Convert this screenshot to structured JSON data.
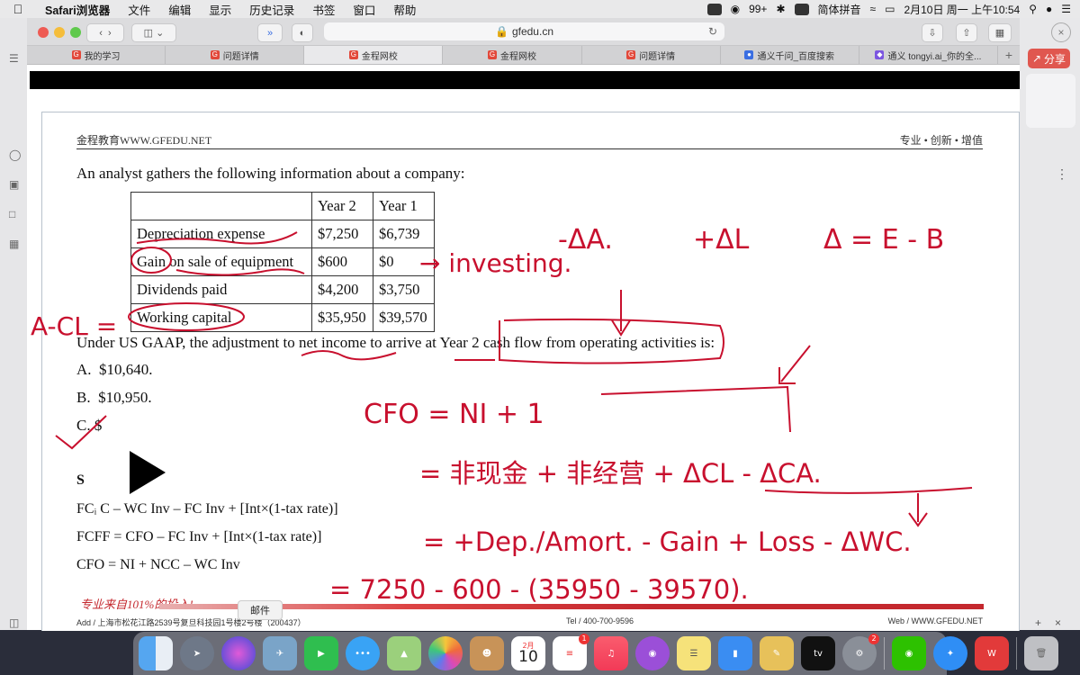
{
  "menubar": {
    "app": "Safari浏览器",
    "items": [
      "文件",
      "编辑",
      "显示",
      "历史记录",
      "书签",
      "窗口",
      "帮助"
    ],
    "notifications": "99+",
    "input_method": "简体拼音",
    "datetime": "2月10日 周一 上午10:54"
  },
  "browser": {
    "url": "gfedu.cn",
    "tabs": [
      {
        "title": "我的学习",
        "active": false
      },
      {
        "title": "问题详情",
        "active": false
      },
      {
        "title": "金程网校",
        "active": true
      },
      {
        "title": "金程网校",
        "active": false
      },
      {
        "title": "问题详情",
        "active": false
      },
      {
        "title": "通义千问_百度搜索",
        "active": false
      },
      {
        "title": "通义 tongyi.ai_你的全...",
        "active": false
      }
    ],
    "share_label": "分享",
    "mail_tooltip": "邮件"
  },
  "doc": {
    "header_left": "金程教育WWW.GFEDU.NET",
    "header_right": "专业 • 创新 • 增值",
    "stem": "An analyst gathers the following information about a company:",
    "table": {
      "headers": [
        "",
        "Year 2",
        "Year 1"
      ],
      "rows": [
        [
          "Depreciation expense",
          "$7,250",
          "$6,739"
        ],
        [
          "Gain on sale of equipment",
          "$600",
          "$0"
        ],
        [
          "Dividends paid",
          "$4,200",
          "$3,750"
        ],
        [
          "Working capital",
          "$35,950",
          "$39,570"
        ]
      ]
    },
    "question": "Under US GAAP, the adjustment to net income to arrive at Year 2 cash flow from operating activities is:",
    "options": [
      {
        "letter": "A.",
        "text": "$10,640."
      },
      {
        "letter": "B.",
        "text": "$10,950."
      },
      {
        "letter": "C.",
        "text": "$"
      }
    ],
    "solution_label": "S",
    "formulas": [
      "FCᵢ          C – WC Inv – FC Inv + [Int×(1-tax rate)]",
      "FCFF = CFO – FC Inv + [Int×(1-tax rate)]",
      "CFO = NI + NCC – WC Inv"
    ],
    "footer_slogan": "专业来自101%的投入!",
    "footer_addr": "Add / 上海市松花江路2539号复旦科技园1号楼2号楼（200437）",
    "footer_tel": "Tel / 400-700-9596",
    "footer_web": "Web / WWW.GFEDU.NET"
  },
  "annotations": {
    "minus_dA": "-ΔA.",
    "plus_dL": "+ΔL",
    "delta_eq": "Δ = E - B",
    "investing": "→ investing.",
    "a_minus_cl": "A-CL =",
    "cfo_eq": "CFO = NI + 1",
    "line2": "= 非现金 + 非经营 + ΔCL - ΔCA.",
    "line3": "= +Dep./Amort. - Gain + Loss - ΔWC.",
    "line4": "= 7250 - 600 - (35950 - 39570)."
  },
  "dock": {
    "calendar_month": "2月",
    "calendar_day": "10",
    "reminders_badge": "1",
    "prefs_badge": "2",
    "tv_label": "tv"
  }
}
